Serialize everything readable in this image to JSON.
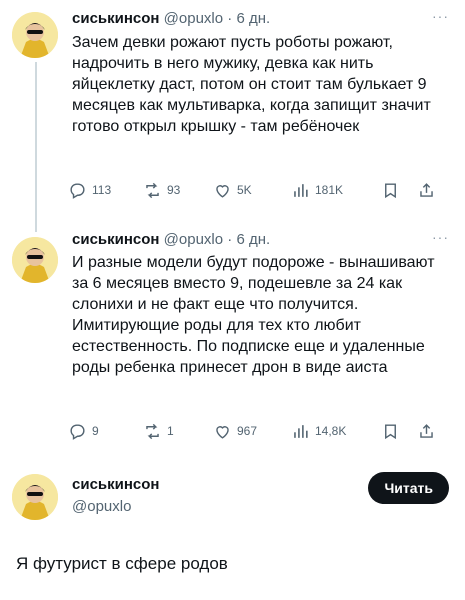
{
  "tweets": [
    {
      "name": "сиськинсон",
      "handle": "@opuxlo",
      "dot": "·",
      "time": "6 дн.",
      "more": "···",
      "text": "Зачем девки рожают пусть роботы рожают, надрочить в него мужику, девка как нить яйцеклетку даст, потом он стоит там булькает 9 месяцев как мультиварка, когда запищит значит готово открыл крышку - там ребёночек",
      "replies": "113",
      "reposts": "93",
      "likes": "5K",
      "views": "181K"
    },
    {
      "name": "сиськинсон",
      "handle": "@opuxlo",
      "dot": "·",
      "time": "6 дн.",
      "more": "···",
      "text": "И разные модели будут подороже - вынашивают за 6 месяцев вместо 9, подешевле за 24 как слонихи и не факт еще что получится. Имитирующие роды для тех кто любит естественность. По подписке еще и удаленные роды ребенка принесет дрон в виде аиста",
      "replies": "9",
      "reposts": "1",
      "likes": "967",
      "views": "14,8K"
    }
  ],
  "profile": {
    "name": "сиськинсон",
    "handle": "@opuxlo",
    "follow_label": "Читать"
  },
  "caption": "Я футурист в сфере родов",
  "icons": {
    "reply": "reply-icon",
    "repost": "repost-icon",
    "like": "like-icon",
    "views": "views-icon",
    "bookmark": "bookmark-icon",
    "share": "share-icon"
  }
}
